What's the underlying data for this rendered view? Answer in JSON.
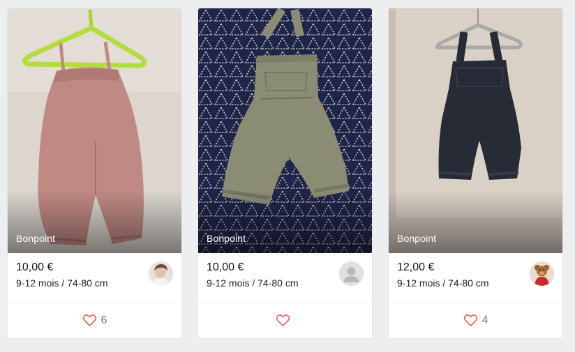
{
  "items": [
    {
      "brand": "Bonpoint",
      "price": "10,00 €",
      "size": "9-12 mois / 74-80 cm",
      "favorites": "6",
      "avatar": "seller-photo",
      "colors": {
        "item": "#c08a84",
        "background": "#dcd6cf"
      }
    },
    {
      "brand": "Bonpoint",
      "price": "10,00 €",
      "size": "9-12 mois / 74-80 cm",
      "favorites": "",
      "avatar": "default-user-icon",
      "colors": {
        "item": "#8a8c74",
        "background": "#20264a"
      }
    },
    {
      "brand": "Bonpoint",
      "price": "12,00 €",
      "size": "9-12 mois / 74-80 cm",
      "favorites": "4",
      "avatar": "teddy-bear-avatar",
      "colors": {
        "item": "#262b36",
        "background": "#d9d1c6"
      }
    }
  ],
  "icons": {
    "favorite": "heart-outline-icon"
  },
  "colors": {
    "heart": "#e8584d",
    "page_background": "#eceeef",
    "card_background": "#ffffff"
  }
}
